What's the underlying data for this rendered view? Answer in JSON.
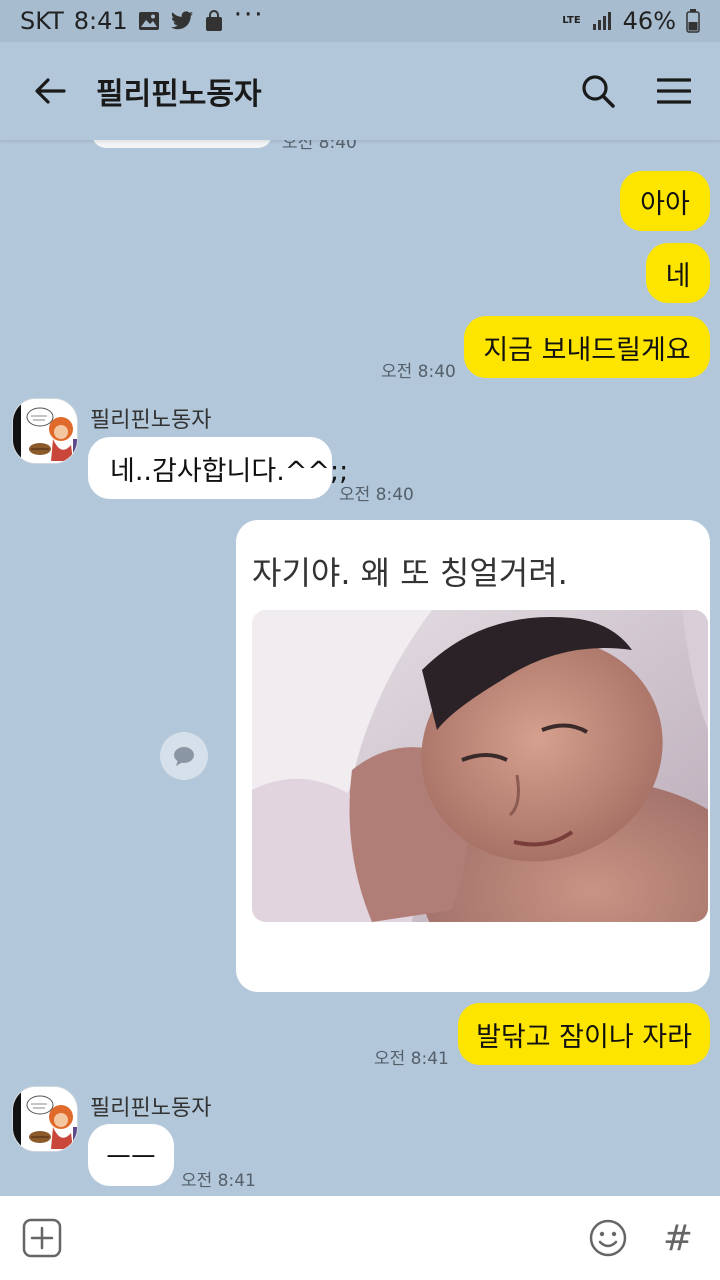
{
  "status_bar": {
    "carrier": "SKT",
    "time": "8:41",
    "battery": "46%",
    "network": "LTE",
    "more": "···"
  },
  "header": {
    "title": "필리핀노동자"
  },
  "messages": {
    "partial_time": "오전 8:40",
    "me1": "아아",
    "me2": "네",
    "me3": "지금 보내드릴게요",
    "me3_time": "오전 8:40",
    "other1_sender": "필리핀노동자",
    "other1_text": "네..감사합니다.^^;;",
    "other1_time": "오전 8:40",
    "image_caption": "자기야. 왜 또 칭얼거려.",
    "me4": "발닦고 잠이나 자라",
    "me4_time": "오전 8:41",
    "other2_sender": "필리핀노동자",
    "other2_text": "ㅡㅡ",
    "other2_time": "오전 8:41"
  },
  "colors": {
    "background": "#b2c7da",
    "my_bubble": "#fee500",
    "other_bubble": "#ffffff"
  },
  "icons": {
    "back": "arrow-left-icon",
    "search": "search-icon",
    "menu": "menu-icon",
    "share": "speech-bubble-icon",
    "plus": "plus-square-icon",
    "emoji": "smiley-icon",
    "hash": "hash-icon"
  },
  "input_bar": {
    "hash_symbol": "#"
  }
}
